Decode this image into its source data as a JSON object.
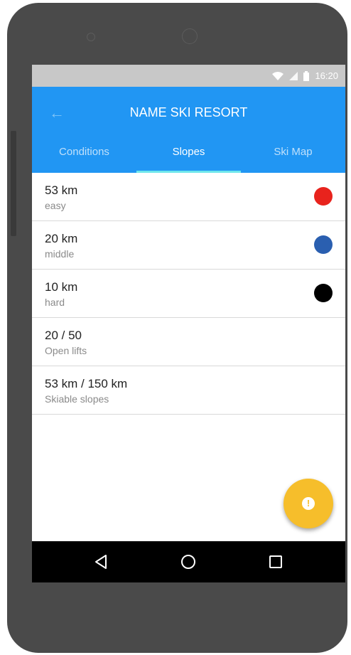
{
  "status_bar": {
    "time": "16:20"
  },
  "header": {
    "title": "NAME SKI RESORT",
    "back_icon": "arrow-back-icon"
  },
  "tabs": [
    {
      "label": "Conditions",
      "active": false
    },
    {
      "label": "Slopes",
      "active": true
    },
    {
      "label": "Ski Map",
      "active": false
    }
  ],
  "slopes": [
    {
      "value": "53 km",
      "label": "easy",
      "color": "#e8231d"
    },
    {
      "value": "20 km",
      "label": "middle",
      "color": "#2a5fb0"
    },
    {
      "value": "10 km",
      "label": "hard",
      "color": "#000000"
    },
    {
      "value": "20 / 50",
      "label": "Open lifts"
    },
    {
      "value": "53 km / 150 km",
      "label": "Skiable slopes"
    }
  ],
  "fab": {
    "icon": "alert-icon",
    "color": "#f6be2b",
    "glyph": "!"
  },
  "nav": {
    "back_icon": "nav-back-icon",
    "home_icon": "nav-home-icon",
    "recents_icon": "nav-recents-icon"
  },
  "colors": {
    "primary": "#2196f3",
    "indicator": "#6fe7ec",
    "status_bar": "#c8c8c8"
  }
}
